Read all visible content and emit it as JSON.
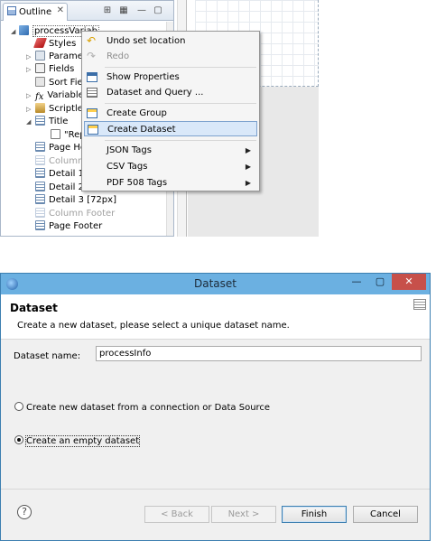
{
  "outline": {
    "tab_label": "Outline",
    "tree": {
      "root": "processVariab",
      "items": [
        {
          "label": "Styles"
        },
        {
          "label": "Paramet"
        },
        {
          "label": "Fields"
        },
        {
          "label": "Sort Fiel"
        },
        {
          "label": "Variable"
        },
        {
          "label": "Scriptlet"
        },
        {
          "label": "Title"
        },
        {
          "label": "\"Rep"
        },
        {
          "label": "Page He"
        },
        {
          "label": "Column"
        },
        {
          "label": "Detail 1"
        },
        {
          "label": "Detail 2"
        },
        {
          "label": "Detail 3 [72px]"
        },
        {
          "label": "Column Footer"
        },
        {
          "label": "Page Footer"
        }
      ]
    }
  },
  "context_menu": {
    "items": [
      {
        "label": "Undo set location",
        "icon": "undo-icon"
      },
      {
        "label": "Redo",
        "icon": "redo-icon"
      },
      {
        "label": "Show Properties",
        "icon": "properties-icon"
      },
      {
        "label": "Dataset and Query ...",
        "icon": "dataset-query-icon"
      },
      {
        "label": "Create Group",
        "icon": "create-group-icon"
      },
      {
        "label": "Create Dataset",
        "icon": "create-dataset-icon"
      },
      {
        "label": "JSON Tags"
      },
      {
        "label": "CSV Tags"
      },
      {
        "label": "PDF 508 Tags"
      }
    ]
  },
  "dialog": {
    "title": "Dataset",
    "heading": "Dataset",
    "description": "Create a new dataset, please select a unique dataset name.",
    "name_label": "Dataset name:",
    "name_value": "processInfo",
    "option_connection": "Create new dataset from a connection or Data Source",
    "option_empty": "Create an empty dataset",
    "selected_option": "empty",
    "buttons": {
      "back": "< Back",
      "next": "Next >",
      "finish": "Finish",
      "cancel": "Cancel"
    }
  }
}
